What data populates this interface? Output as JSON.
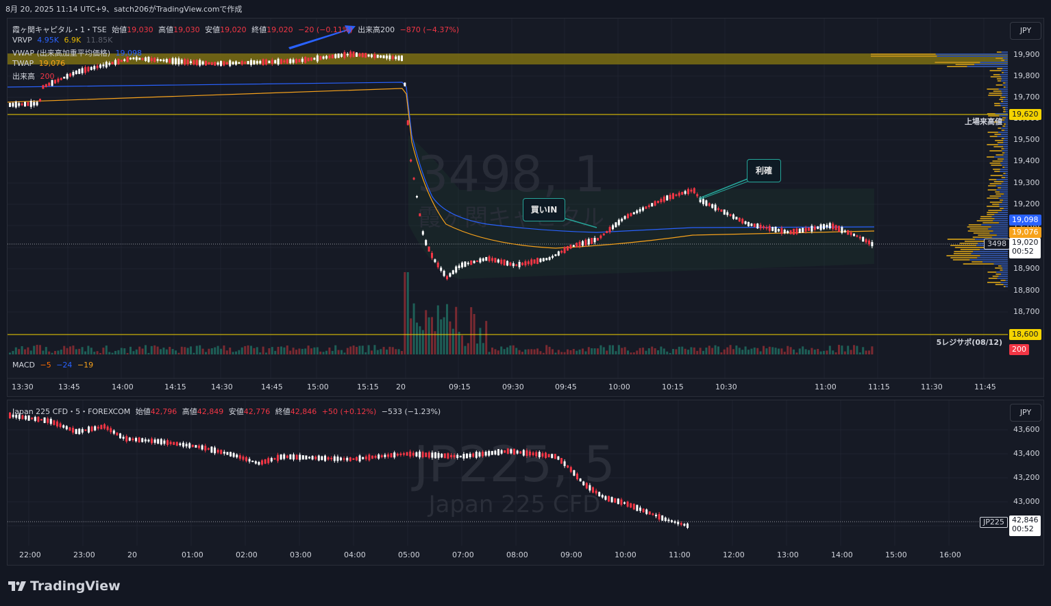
{
  "header": {
    "caption": "8月 20, 2025 11:14 UTC+9、satch206がTradingView.comで作成"
  },
  "pane1": {
    "symbol": "霞ヶ関キャピタル・1・TSE",
    "open_label": "始値",
    "open": "19,030",
    "high_label": "高値",
    "high": "19,030",
    "low_label": "安値",
    "low": "19,020",
    "close_label": "終値",
    "close": "19,020",
    "change": "−20 (−0.11%)",
    "volume_label": "出来高",
    "volume": "200",
    "volume_change": "−870 (−4.37%)",
    "vrvp_label": "VRVP",
    "vrvp_1": "4.95K",
    "vrvp_2": "6.9K",
    "vrvp_3": "11.85K",
    "vwap_label": "VWAP (出来高加重平均価格)",
    "vwap_value": "19,098",
    "twap_label": "TWAP",
    "twap_value": "19,076",
    "vol_label": "出来高",
    "vol_value": "200",
    "macd_label": "MACD",
    "macd_1": "−5",
    "macd_2": "−24",
    "macd_3": "−19",
    "currency": "JPY",
    "watermark_big": "3498, 1",
    "watermark_small": "霞ヶ関キャピタル",
    "price_axis": [
      "19,900",
      "19,800",
      "19,700",
      "19,600",
      "19,500",
      "19,400",
      "19,300",
      "19,200",
      "19,100",
      "19,000",
      "18,900",
      "18,800",
      "18,700"
    ],
    "time_axis": [
      "13:30",
      "13:45",
      "14:00",
      "14:15",
      "14:30",
      "14:45",
      "15:00",
      "15:15",
      "20",
      "09:15",
      "09:30",
      "09:45",
      "10:00",
      "10:15",
      "10:30",
      "11:00",
      "11:15",
      "11:30",
      "11:45"
    ],
    "tags": {
      "high_line": "19,620",
      "high_line_label": "上場来高値",
      "vwap": "19,098",
      "twap": "19,076",
      "symbol_tag": "3498",
      "last": "19,020",
      "countdown": "00:52",
      "support_line": "18,600",
      "support_label": "5レジサポ(08/12)",
      "volume": "200"
    },
    "callout_buy": "買いIN",
    "callout_take": "利確"
  },
  "pane2": {
    "symbol": "Japan 225 CFD・5・FOREXCOM",
    "open_label": "始値",
    "open": "42,796",
    "high_label": "高値",
    "high": "42,849",
    "low_label": "安値",
    "low": "42,776",
    "close_label": "終値",
    "close": "42,846",
    "change": "+50 (+0.12%)",
    "day_change": "−533 (−1.23%)",
    "currency": "JPY",
    "watermark_big": "JP225, 5",
    "watermark_small": "Japan 225 CFD",
    "price_axis": [
      "43,600",
      "43,400",
      "43,200",
      "43,000"
    ],
    "time_axis": [
      "22:00",
      "23:00",
      "20",
      "01:00",
      "02:00",
      "03:00",
      "04:00",
      "05:00",
      "07:00",
      "08:00",
      "09:00",
      "10:00",
      "11:00",
      "12:00",
      "13:00",
      "14:00",
      "15:00",
      "16:00"
    ],
    "tags": {
      "symbol_tag": "JP225",
      "last": "42,846",
      "countdown": "00:52"
    }
  },
  "colors": {
    "up": "#f23645",
    "down": "#ffffff",
    "vwap": "#2962ff",
    "twap": "#f7a21b",
    "hline": "#f5d400",
    "callout": "#26a69a"
  },
  "logo": "TradingView"
}
